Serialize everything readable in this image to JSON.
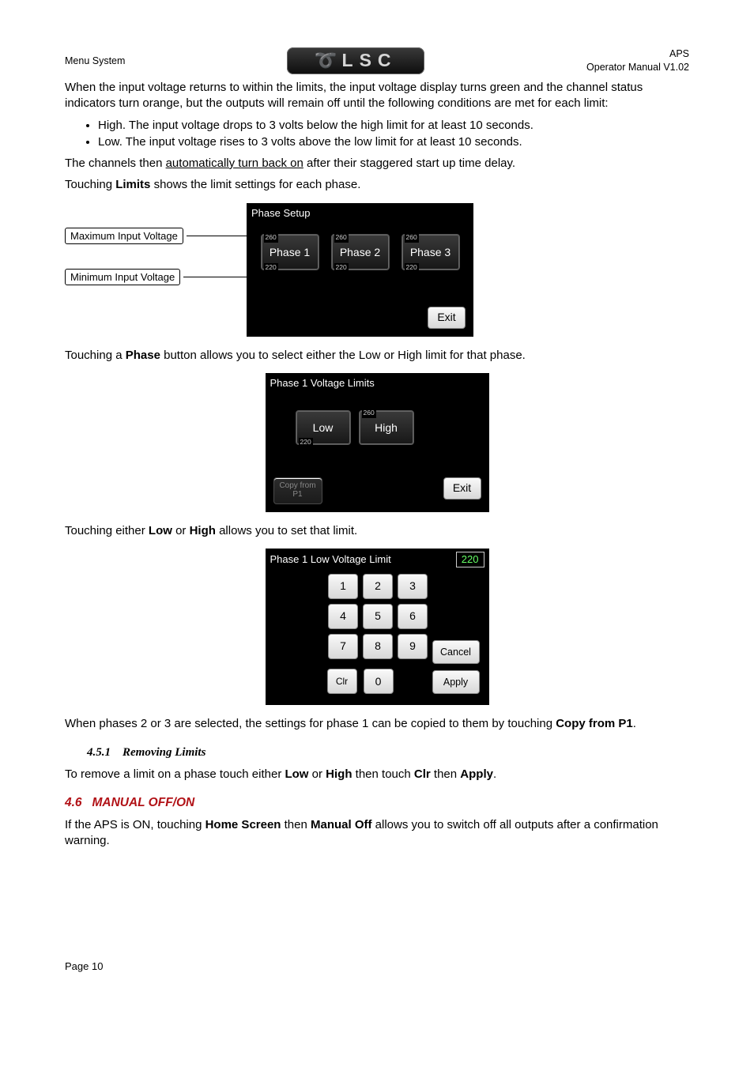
{
  "header": {
    "left": "Menu System",
    "right_top": "APS",
    "right_bottom": "Operator Manual V1.02",
    "logo_text": "LSC"
  },
  "intro": {
    "p1": "When the input voltage returns to within the limits, the input voltage display turns green and the channel status indicators turn orange, but the outputs will remain off until the following conditions are met for each limit:",
    "b1": "High. The input voltage drops to 3 volts below the high limit for at least 10 seconds.",
    "b2": "Low. The input voltage rises to 3 volts above the low limit for at least 10 seconds.",
    "p2_pre": "The channels then ",
    "p2_ul": "automatically turn back on",
    "p2_post": " after their staggered start up time delay.",
    "p3_pre": "Touching ",
    "p3_b": "Limits",
    "p3_post": " shows the limit settings for each phase."
  },
  "fig1": {
    "callout_max": "Maximum Input Voltage",
    "callout_min": "Minimum Input Voltage",
    "title": "Phase Setup",
    "high": "260",
    "low": "220",
    "phase1": "Phase 1",
    "phase2": "Phase 2",
    "phase3": "Phase 3",
    "exit": "Exit"
  },
  "mid1_pre": "Touching a ",
  "mid1_b": "Phase",
  "mid1_post": " button allows you to select either the Low or High limit for that phase.",
  "fig2": {
    "title": "Phase 1 Voltage Limits",
    "low": "Low",
    "high": "High",
    "lowv": "220",
    "highv": "260",
    "copy": "Copy from P1",
    "exit": "Exit"
  },
  "mid2_pre": "Touching either ",
  "mid2_b1": "Low",
  "mid2_mid": " or ",
  "mid2_b2": "High",
  "mid2_post": " allows you to set that limit.",
  "fig3": {
    "title": "Phase 1 Low Voltage Limit",
    "value": "220",
    "k1": "1",
    "k2": "2",
    "k3": "3",
    "k4": "4",
    "k5": "5",
    "k6": "6",
    "k7": "7",
    "k8": "8",
    "k9": "9",
    "k0": "0",
    "clr": "Clr",
    "cancel": "Cancel",
    "apply": "Apply"
  },
  "post": {
    "p_pre": "When phases 2 or 3 are selected, the settings for phase 1 can be copied to them by touching ",
    "p_b": "Copy from P1",
    "p_post": "."
  },
  "sec451": {
    "num": "4.5.1",
    "title": "Removing Limits",
    "p_pre": "To remove a limit on a phase touch either ",
    "b1": "Low",
    "m1": " or ",
    "b2": "High",
    "m2": " then touch ",
    "b3": "Clr",
    "m3": " then ",
    "b4": "Apply",
    "p_post": "."
  },
  "sec46": {
    "num": "4.6",
    "title": "MANUAL OFF/ON",
    "p_pre": "If the APS is ON, touching ",
    "b1": "Home Screen",
    "m1": " then ",
    "b2": "Manual Off",
    "p_post": " allows you to switch off all outputs after a confirmation warning."
  },
  "footer": "Page 10"
}
